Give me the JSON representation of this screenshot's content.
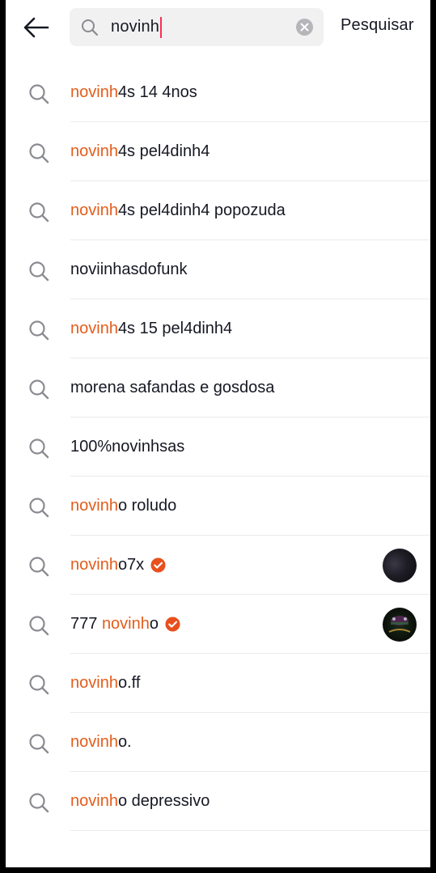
{
  "search": {
    "query": "novinh",
    "submit_label": "Pesquisar"
  },
  "colors": {
    "highlight": "#e45d1b",
    "caret": "#fe2c55",
    "verified": "#e8501d"
  },
  "suggestions": [
    {
      "highlight": "novinh",
      "rest": "4s 14 4nos",
      "prefix": "",
      "verified": false,
      "avatar": false
    },
    {
      "highlight": "novinh",
      "rest": "4s pel4dinh4",
      "prefix": "",
      "verified": false,
      "avatar": false
    },
    {
      "highlight": "novinh",
      "rest": "4s pel4dinh4 popozuda",
      "prefix": "",
      "verified": false,
      "avatar": false
    },
    {
      "highlight": "",
      "rest": "noviinhasdofunk",
      "prefix": "",
      "verified": false,
      "avatar": false
    },
    {
      "highlight": "novinh",
      "rest": "4s 15 pel4dinh4",
      "prefix": "",
      "verified": false,
      "avatar": false
    },
    {
      "highlight": "",
      "rest": "morena safandas e gosdosa",
      "prefix": "",
      "verified": false,
      "avatar": false
    },
    {
      "highlight": "",
      "rest": "100%novinhsas",
      "prefix": "",
      "verified": false,
      "avatar": false
    },
    {
      "highlight": "novinh",
      "rest": "o roludo",
      "prefix": "",
      "verified": false,
      "avatar": false
    },
    {
      "highlight": "novinh",
      "rest": "o7x",
      "prefix": "",
      "verified": true,
      "avatar": true
    },
    {
      "highlight": "novinh",
      "rest": "o",
      "prefix": "777 ",
      "verified": true,
      "avatar": true
    },
    {
      "highlight": "novinh",
      "rest": "o.ff",
      "prefix": "",
      "verified": false,
      "avatar": false
    },
    {
      "highlight": "novinh",
      "rest": "o.",
      "prefix": "",
      "verified": false,
      "avatar": false
    },
    {
      "highlight": "novinh",
      "rest": "o depressivo",
      "prefix": "",
      "verified": false,
      "avatar": false
    }
  ],
  "icons": {
    "back": "arrow-left-icon",
    "search": "search-icon",
    "clear": "clear-icon",
    "suggestion": "search-icon",
    "verified": "verified-badge-icon"
  }
}
